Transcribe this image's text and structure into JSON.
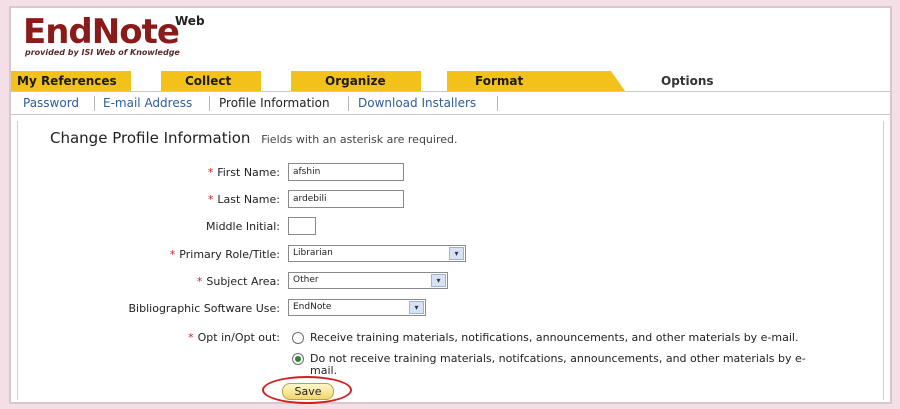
{
  "logo": {
    "main": "EndNote",
    "web": "Web",
    "sub": "provided by ISI Web of Knowledge"
  },
  "tabs": [
    {
      "label": "My References"
    },
    {
      "label": "Collect"
    },
    {
      "label": "Organize"
    },
    {
      "label": "Format"
    },
    {
      "label": "Options"
    }
  ],
  "subtabs": [
    {
      "label": "Password"
    },
    {
      "label": "E-mail Address"
    },
    {
      "label": "Profile Information"
    },
    {
      "label": "Download Installers"
    }
  ],
  "form": {
    "title": "Change Profile Information",
    "note": "Fields with an asterisk are required.",
    "first_name_label": "First Name:",
    "first_name_value": "afshin",
    "last_name_label": "Last Name:",
    "last_name_value": "ardebili",
    "middle_initial_label": "Middle Initial:",
    "middle_initial_value": "",
    "role_label": "Primary Role/Title:",
    "role_value": "Librarian",
    "subject_label": "Subject Area:",
    "subject_value": "Other",
    "software_label": "Bibliographic Software Use:",
    "software_value": "EndNote",
    "opt_label": "Opt in/Opt out:",
    "opt_in_text": "Receive training materials, notifications, announcements, and other materials by e-mail.",
    "opt_out_text": "Do not receive training materials, notifcations, announcements, and other materials by e-",
    "opt_out_text_2": "mail.",
    "save_label": "Save"
  },
  "colors": {
    "tab_yellow": "#f3c21a",
    "logo_red": "#8b1a1a",
    "link_blue": "#2d5d9a",
    "highlight_red": "#d21f1f"
  }
}
